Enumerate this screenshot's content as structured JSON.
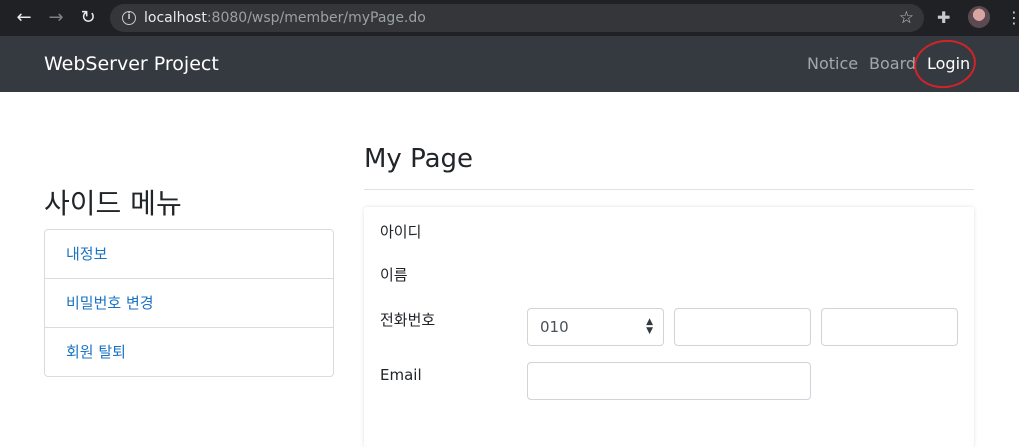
{
  "browser": {
    "url_host": "localhost",
    "url_rest": ":8080/wsp/member/myPage.do",
    "icons": [
      "back-icon",
      "forward-icon",
      "reload-icon",
      "info-icon",
      "star-icon",
      "extensions-icon",
      "profile-icon",
      "menu-icon"
    ]
  },
  "navbar": {
    "brand": "WebServer Project",
    "links": [
      {
        "label": "Notice"
      },
      {
        "label": "Board"
      },
      {
        "label": "Login"
      }
    ],
    "annotation_color": "#d0242a",
    "background": "#343a40"
  },
  "sidebar": {
    "title": "사이드 메뉴",
    "items": [
      {
        "label": "내정보"
      },
      {
        "label": "비밀번호 변경"
      },
      {
        "label": "회원 탈퇴"
      }
    ]
  },
  "main": {
    "title": "My Page",
    "fields": {
      "id_label": "아이디",
      "name_label": "이름",
      "phone_label": "전화번호",
      "phone_prefix": "010",
      "phone_middle": "",
      "phone_last": "",
      "email_label": "Email",
      "email_value": ""
    }
  }
}
